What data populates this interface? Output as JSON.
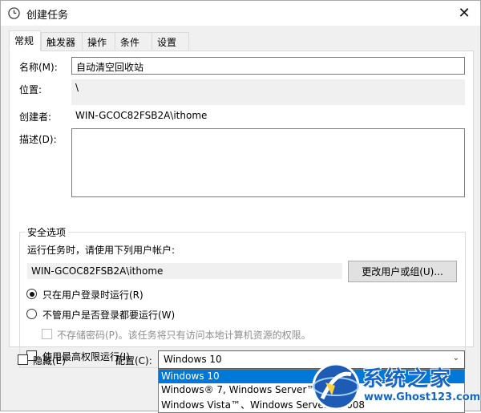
{
  "window": {
    "title": "创建任务",
    "close_glyph": "✕"
  },
  "tabs": [
    {
      "label": "常规",
      "active": true
    },
    {
      "label": "触发器"
    },
    {
      "label": "操作"
    },
    {
      "label": "条件"
    },
    {
      "label": "设置"
    }
  ],
  "general": {
    "name_label": "名称(M):",
    "name_value": "自动清空回收站",
    "location_label": "位置:",
    "location_value": "\\",
    "author_label": "创建者:",
    "author_value": "WIN-GCOC82FSB2A\\ithome",
    "description_label": "描述(D):",
    "description_value": ""
  },
  "security": {
    "legend": "安全选项",
    "run_as_label": "运行任务时，请使用下列用户帐户:",
    "user_account": "WIN-GCOC82FSB2A\\ithome",
    "change_user_button": "更改用户或组(U)...",
    "radio_logged_on": "只在用户登录时运行(R)",
    "radio_logged_on_checked": true,
    "radio_whether_logged": "不管用户是否登录都要运行(W)",
    "dont_store_password": "不存储密码(P)。该任务将只有访问本地计算机资源的权限。",
    "highest_privileges": "使用最高权限运行(I)"
  },
  "footer": {
    "hidden_label": "隐藏(E)",
    "configure_label": "配置(C):",
    "configure_value": "Windows 10",
    "options": [
      "Windows 10",
      "Windows® 7, Windows Server™ 2008 R2",
      "Windows Vista™、Windows Server™ 2008"
    ]
  },
  "watermark": {
    "brand": "系统之家",
    "url": "www.Ghost123.com"
  },
  "colors": {
    "accent": "#0078d7",
    "panel_bg": "#f0f0f0"
  },
  "icons": {
    "title_icon": "clock-icon",
    "close_icon": "close-icon",
    "combo_icon": "chevron-down-icon"
  }
}
